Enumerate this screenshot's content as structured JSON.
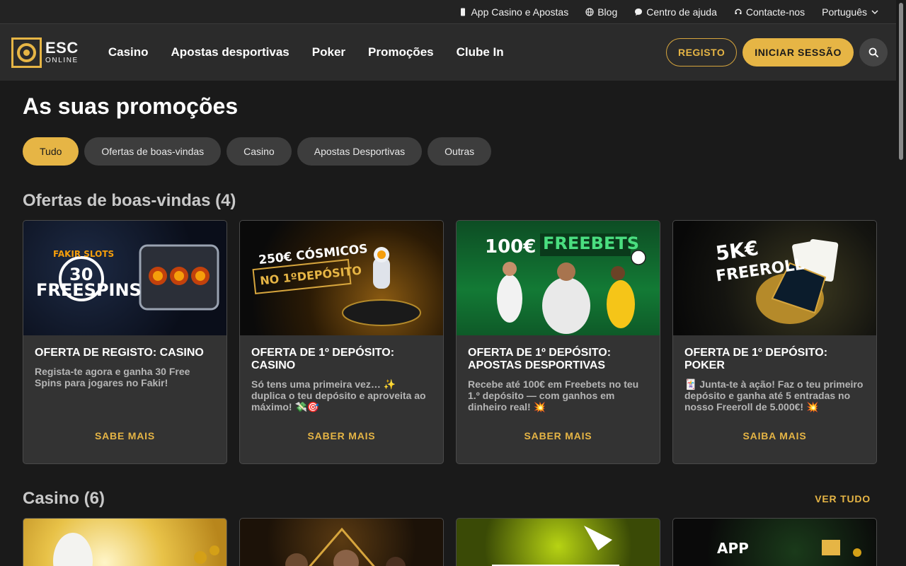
{
  "utility": {
    "items": [
      {
        "label": "App Casino e Apostas",
        "icon": "phone-icon"
      },
      {
        "label": "Blog",
        "icon": "globe-icon"
      },
      {
        "label": "Centro de ajuda",
        "icon": "chat-bubble-icon"
      },
      {
        "label": "Contacte-nos",
        "icon": "headset-icon"
      }
    ],
    "language": "Português"
  },
  "header": {
    "logo_main": "ESC",
    "logo_sub": "ONLINE",
    "nav": [
      "Casino",
      "Apostas desportivas",
      "Poker",
      "Promoções",
      "Clube In"
    ],
    "register_label": "REGISTO",
    "login_label": "INICIAR SESSÃO"
  },
  "page": {
    "title": "As suas promoções",
    "filters": [
      "Tudo",
      "Ofertas de boas-vindas",
      "Casino",
      "Apostas Desportivas",
      "Outras"
    ],
    "active_filter": "Tudo"
  },
  "welcome": {
    "title": "Ofertas de boas-vindas (4)",
    "cards": [
      {
        "title": "OFERTA DE REGISTO: CASINO",
        "desc": "Regista-te agora e ganha 30 Free Spins para jogares no Fakir!",
        "cta": "SABE MAIS",
        "img_line1": "FAKIR SLOTS",
        "img_line2": "30",
        "img_line3": "FREESPINS"
      },
      {
        "title": "OFERTA DE 1º DEPÓSITO: CASINO",
        "desc": "Só tens uma primeira vez… ✨ duplica o teu depósito e aproveita ao máximo! 💸🎯",
        "cta": "SABER MAIS",
        "img_line1": "250€ CÓSMICOS",
        "img_line2": "NO 1ºDEPÓSITO"
      },
      {
        "title": "OFERTA DE 1º DEPÓSITO: APOSTAS DESPORTIVAS",
        "desc": "Recebe até 100€ em Freebets no teu 1.º depósito — com ganhos em dinheiro real! 💥",
        "cta": "SABER MAIS",
        "img_line1": "100€",
        "img_line2": "FREEBETS"
      },
      {
        "title": "OFERTA DE 1º DEPÓSITO: POKER",
        "desc": "🃏 Junta-te à ação! Faz o teu primeiro depósito e ganha até 5 entradas no nosso Freeroll de 5.000€! 💥",
        "cta": "SAIBA MAIS",
        "img_line1": "5K€",
        "img_line2": "FREEROLL"
      }
    ]
  },
  "casino": {
    "title": "Casino (6)",
    "see_all": "VER TUDO",
    "img_app": "APP"
  },
  "colors": {
    "accent": "#e6b545",
    "background": "#1a1a1a",
    "header": "#2b2b2b",
    "card": "#333333"
  }
}
